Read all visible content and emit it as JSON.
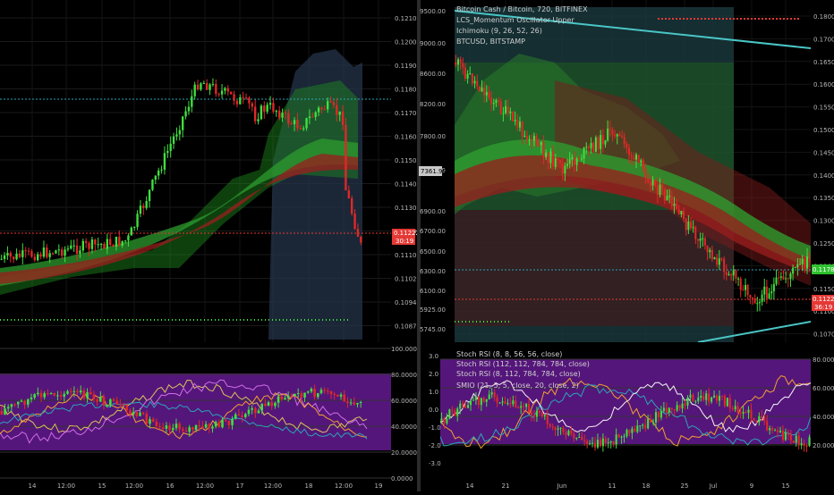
{
  "colors": {
    "bg": "#000000",
    "grid": "#1c1c1c",
    "up": "#3fe03f",
    "down": "#e02828",
    "osc_band": "#6a1b9a",
    "kumo_green": "#1f8f1f",
    "kumo_red": "#8f1515",
    "last_red": "#e53935",
    "last_green": "#2ec12e"
  },
  "left_chart": {
    "price_ticks": [
      "0.12100",
      "0.12000",
      "0.11900",
      "0.11800",
      "0.11700",
      "0.11600",
      "0.11500",
      "0.11400",
      "0.11300",
      "0.11200",
      "0.11100",
      "0.11020",
      "0.10940",
      "0.10870"
    ],
    "last_price": "0.11222",
    "countdown": "30:19",
    "osc_ticks": [
      "100.0000",
      "80.0000",
      "60.0000",
      "40.0000",
      "20.0000",
      "0.0000"
    ],
    "time_ticks": [
      "14",
      "12:00",
      "15",
      "12:00",
      "16",
      "12:00",
      "17",
      "12:00",
      "18",
      "12:00",
      "19"
    ]
  },
  "right_chart": {
    "legend": [
      "Bitcoin Cash / Bitcoin, 720, BITFINEX",
      "LCS_Momentum Oscillator Upper",
      "Ichimoku (9, 26, 52, 26)",
      "BTCUSD, BITSTAMP"
    ],
    "left_ticks": [
      "9500.00",
      "9000.00",
      "8600.00",
      "8200.00",
      "7800.00",
      "7361.99",
      "6900.00",
      "6700.00",
      "6500.00",
      "6300.00",
      "6100.00",
      "5925.00",
      "5745.00"
    ],
    "right_ticks": [
      "0.18000",
      "0.17000",
      "0.16500",
      "0.16000",
      "0.15500",
      "0.15000",
      "0.14500",
      "0.14000",
      "0.13500",
      "0.13000",
      "0.12500",
      "0.12000",
      "0.11500",
      "0.11000",
      "0.10700"
    ],
    "btc_tag": "7361.99",
    "green_tag": "0.11783",
    "last_price": "0.11222",
    "countdown": "36:19",
    "osc_legend": [
      "Stoch RSI (8, 8, 56, 56, close)",
      "Stoch RSI (112, 112, 784, 784, close)",
      "Stoch RSI (8, 112, 784, 784, close)",
      "SMIO (21, 5, 5, close, 20, close, 2)"
    ],
    "osc_left_ticks": [
      "3.0",
      "2.0",
      "1.0",
      "0.0",
      "-1.0",
      "-2.0",
      "-3.0"
    ],
    "osc_right_ticks": [
      "80.0000",
      "60.0000",
      "40.0000",
      "20.0000"
    ],
    "time_ticks": [
      "14",
      "21",
      "Jun",
      "11",
      "18",
      "25",
      "Jul",
      "9",
      "15"
    ]
  }
}
